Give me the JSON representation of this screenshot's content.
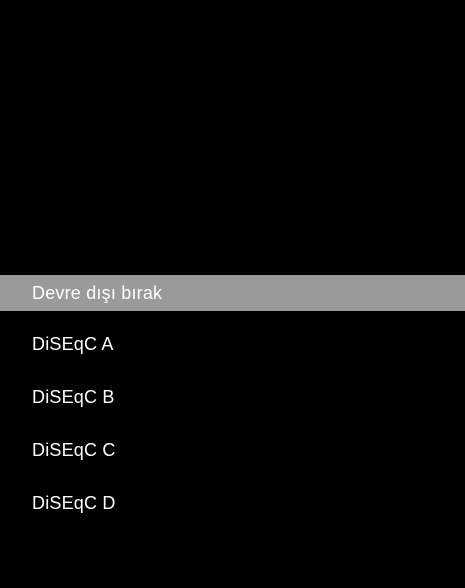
{
  "menu": {
    "items": [
      {
        "label": "Devre dışı bırak",
        "selected": true
      },
      {
        "label": "DiSEqC A",
        "selected": false
      },
      {
        "label": "DiSEqC B",
        "selected": false
      },
      {
        "label": "DiSEqC C",
        "selected": false
      },
      {
        "label": "DiSEqC D",
        "selected": false
      }
    ]
  },
  "colors": {
    "background": "#000000",
    "highlight": "#9a9a9a",
    "text": "#ffffff"
  }
}
